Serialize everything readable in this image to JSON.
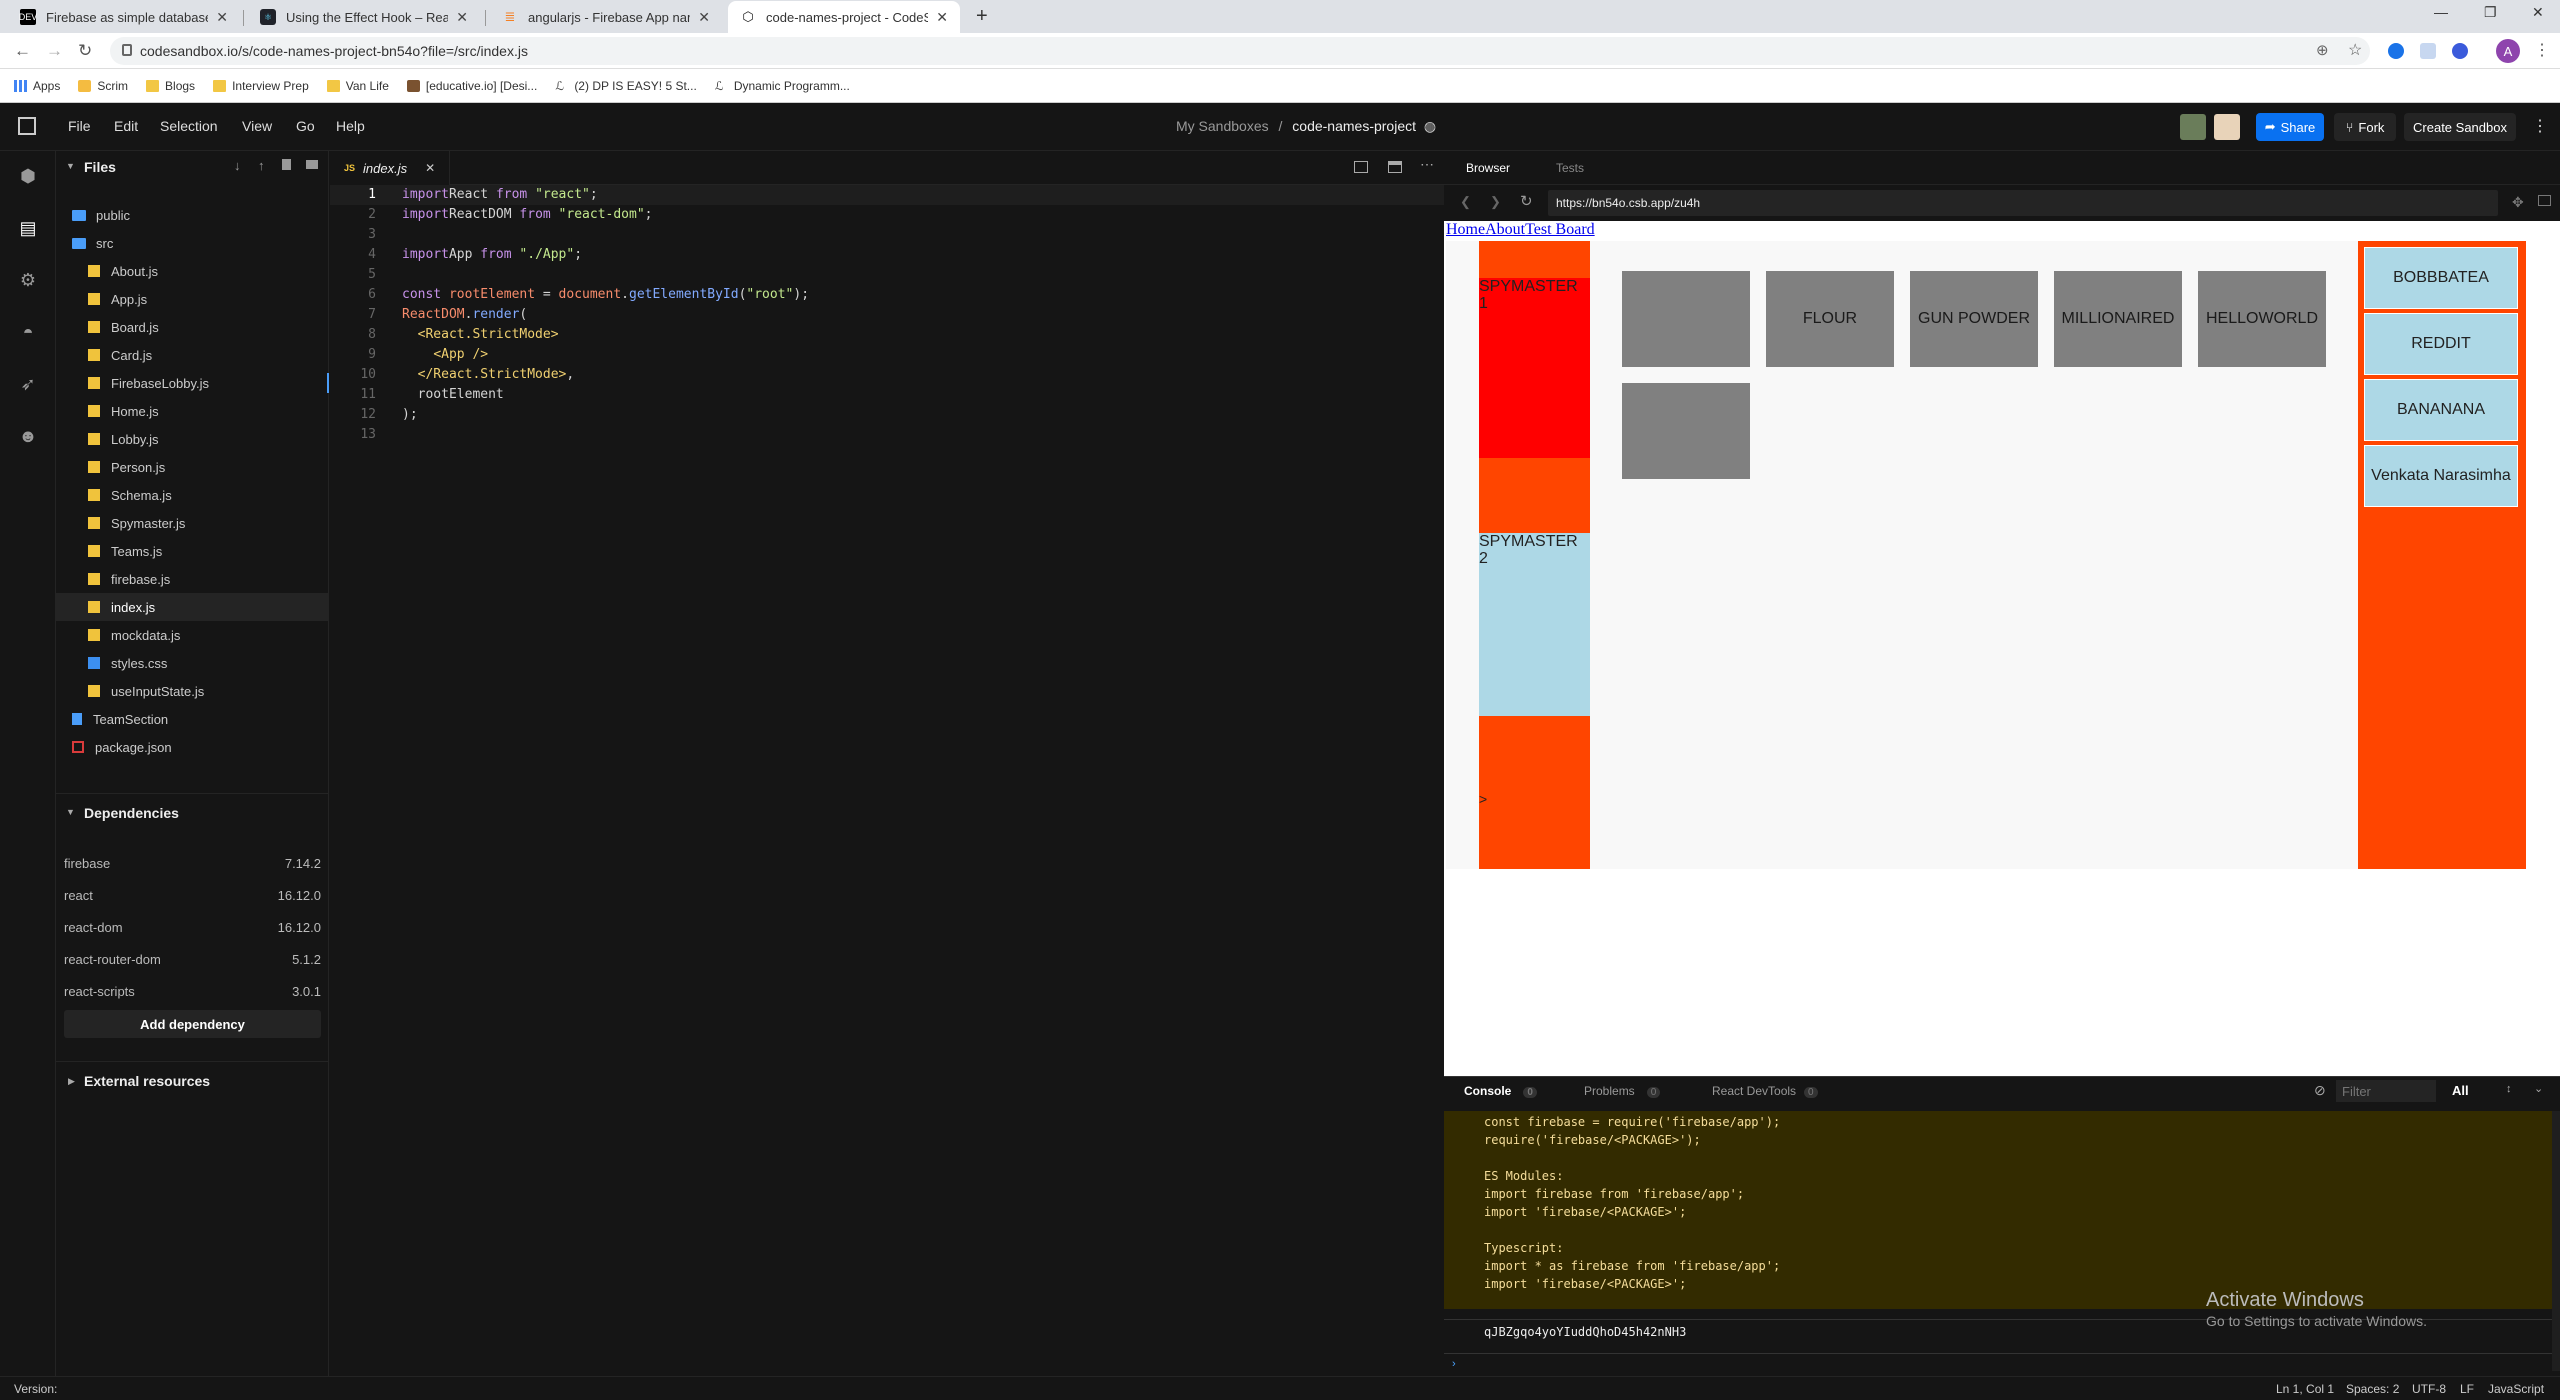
{
  "browser": {
    "tabs": [
      {
        "title": "Firebase as simple database to R",
        "favicon": "DEV"
      },
      {
        "title": "Using the Effect Hook – React",
        "favicon": "react-icon"
      },
      {
        "title": "angularjs - Firebase App named",
        "favicon": "stackoverflow-icon"
      },
      {
        "title": "code-names-project - CodeSand",
        "favicon": "codesandbox-icon"
      }
    ],
    "url": "codesandbox.io/s/code-names-project-bn54o?file=/src/index.js",
    "profile_initial": "A",
    "bookmarks": [
      "Apps",
      "Scrim",
      "Blogs",
      "Interview Prep",
      "Van Life",
      "[educative.io] [Desi...",
      "(2) DP IS EASY! 5 St...",
      "Dynamic Programm..."
    ]
  },
  "csb": {
    "menu": [
      "File",
      "Edit",
      "Selection",
      "View",
      "Go",
      "Help"
    ],
    "breadcrumb_parent": "My Sandboxes",
    "breadcrumb_sep": "/",
    "project_name": "code-names-project",
    "share_label": "Share",
    "fork_label": "Fork",
    "create_label": "Create Sandbox"
  },
  "explorer": {
    "files_header": "Files",
    "tree": [
      {
        "name": "public",
        "type": "folder",
        "indent": 0
      },
      {
        "name": "src",
        "type": "folder-open",
        "indent": 0
      },
      {
        "name": "About.js",
        "type": "js",
        "indent": 1
      },
      {
        "name": "App.js",
        "type": "js",
        "indent": 1
      },
      {
        "name": "Board.js",
        "type": "js",
        "indent": 1
      },
      {
        "name": "Card.js",
        "type": "js",
        "indent": 1
      },
      {
        "name": "FirebaseLobby.js",
        "type": "js",
        "indent": 1
      },
      {
        "name": "Home.js",
        "type": "js",
        "indent": 1
      },
      {
        "name": "Lobby.js",
        "type": "js",
        "indent": 1
      },
      {
        "name": "Person.js",
        "type": "js",
        "indent": 1
      },
      {
        "name": "Schema.js",
        "type": "js",
        "indent": 1
      },
      {
        "name": "Spymaster.js",
        "type": "js",
        "indent": 1
      },
      {
        "name": "Teams.js",
        "type": "js",
        "indent": 1
      },
      {
        "name": "firebase.js",
        "type": "js",
        "indent": 1
      },
      {
        "name": "index.js",
        "type": "js",
        "indent": 1,
        "selected": true
      },
      {
        "name": "mockdata.js",
        "type": "js",
        "indent": 1
      },
      {
        "name": "styles.css",
        "type": "css",
        "indent": 1
      },
      {
        "name": "useInputState.js",
        "type": "js",
        "indent": 1
      },
      {
        "name": "TeamSection",
        "type": "file",
        "indent": 0
      },
      {
        "name": "package.json",
        "type": "json",
        "indent": 0
      }
    ],
    "dependencies_header": "Dependencies",
    "dependencies": [
      {
        "name": "firebase",
        "version": "7.14.2"
      },
      {
        "name": "react",
        "version": "16.12.0"
      },
      {
        "name": "react-dom",
        "version": "16.12.0"
      },
      {
        "name": "react-router-dom",
        "version": "5.1.2"
      },
      {
        "name": "react-scripts",
        "version": "3.0.1"
      }
    ],
    "add_dependency": "Add dependency",
    "external_resources": "External resources"
  },
  "editor": {
    "tab_icon": "JS",
    "tab_name": "index.js",
    "lines": [
      [
        [
          "kw",
          "import"
        ],
        [
          "",
          "React "
        ],
        [
          "kw",
          "from"
        ],
        [
          "str",
          " \"react\""
        ],
        [
          "",
          ";"
        ]
      ],
      [
        [
          "kw",
          "import"
        ],
        [
          "",
          "ReactDOM "
        ],
        [
          "kw",
          "from"
        ],
        [
          "str",
          " \"react-dom\""
        ],
        [
          "",
          ";"
        ]
      ],
      [],
      [
        [
          "kw",
          "import"
        ],
        [
          "",
          "App "
        ],
        [
          "kw",
          "from"
        ],
        [
          "str",
          " \"./App\""
        ],
        [
          "",
          ";"
        ]
      ],
      [],
      [
        [
          "kw",
          "const"
        ],
        [
          "var",
          " rootElement"
        ],
        [
          "",
          " = "
        ],
        [
          "var",
          "document"
        ],
        [
          "",
          "."
        ],
        [
          "fn",
          "getElementById"
        ],
        [
          "",
          "("
        ],
        [
          "str",
          "\"root\""
        ],
        [
          "",
          ");"
        ]
      ],
      [
        [
          "var",
          "ReactDOM"
        ],
        [
          "",
          "."
        ],
        [
          "fn",
          "render"
        ],
        [
          "",
          "("
        ]
      ],
      [
        [
          "",
          "  "
        ],
        [
          "tag",
          "<React.StrictMode>"
        ]
      ],
      [
        [
          "",
          "    "
        ],
        [
          "tag",
          "<App />"
        ]
      ],
      [
        [
          "",
          "  "
        ],
        [
          "tag",
          "</React.StrictMode>"
        ],
        [
          "",
          ","
        ]
      ],
      [
        [
          "",
          "  rootElement"
        ]
      ],
      [
        [
          "",
          ");"
        ]
      ],
      []
    ]
  },
  "preview": {
    "browser_tab": "Browser",
    "tests_tab": "Tests",
    "url": "https://bn54o.csb.app/zu4h",
    "links": [
      "Home",
      "About",
      "Test Board"
    ],
    "spymaster1": "SPYMASTER 1",
    "spymaster2": "SPYMASTER 2",
    "arrow": ">",
    "cards": [
      "",
      "FLOUR",
      "GUN POWDER",
      "MILLIONAIRED",
      "HELLOWORLD",
      ""
    ],
    "right_cards": [
      "BOBBBATEA",
      "REDDIT",
      "BANANANA",
      "Venkata Narasimha"
    ],
    "colors": {
      "red": "#ff0000",
      "orange": "#ff4500",
      "lightblue": "#add8e6",
      "card": "#808080"
    }
  },
  "console": {
    "tabs": [
      {
        "label": "Console",
        "count": "0"
      },
      {
        "label": "Problems",
        "count": "0"
      },
      {
        "label": "React DevTools",
        "count": "0"
      }
    ],
    "filter_placeholder": "Filter",
    "level": "All",
    "lines": [
      "const firebase = require('firebase/app');",
      "require('firebase/<PACKAGE>');",
      "",
      "ES Modules:",
      "import firebase from 'firebase/app';",
      "import 'firebase/<PACKAGE>';",
      "",
      "Typescript:",
      "import * as firebase from 'firebase/app';",
      "import 'firebase/<PACKAGE>';"
    ],
    "last_line": "qJBZgqo4yoYIuddQhoD45h42nNH3",
    "watermark_title": "Activate Windows",
    "watermark_sub": "Go to Settings to activate Windows."
  },
  "status": {
    "version": "Version:",
    "position": "Ln 1, Col 1",
    "spaces": "Spaces: 2",
    "encoding": "UTF-8",
    "eol": "LF",
    "language": "JavaScript"
  }
}
